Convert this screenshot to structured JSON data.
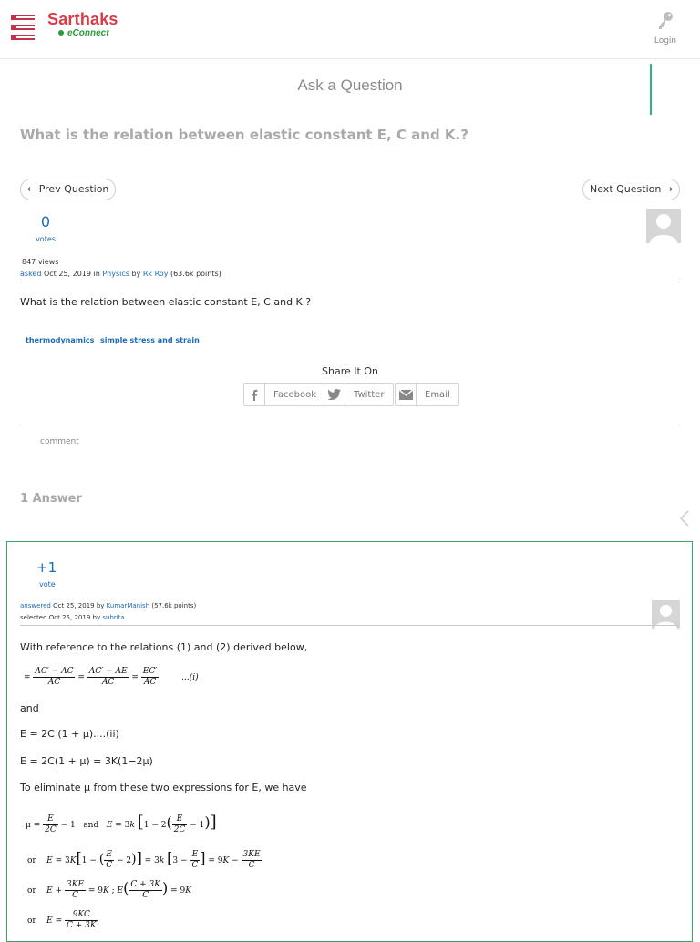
{
  "header": {
    "brand_name": "Sarthaks",
    "brand_sub": "eConnect",
    "login_label": "Login"
  },
  "ask_label": "Ask a Question",
  "question": {
    "title": "What is the relation between elastic constant E, C and K.?",
    "prev_label": "← Prev Question",
    "next_label": "Next Question →",
    "votes": "0",
    "votes_label": "votes",
    "views": "847 views",
    "asked_label": "asked",
    "asked_date": "Oct 25, 2019 in",
    "category": "Physics",
    "by_label": "by",
    "author": "Rk Roy",
    "author_points": "(63.6k points)",
    "body": "What is the relation between elastic constant E, C and K.?",
    "tags": [
      "thermodynamics",
      "simple stress and strain"
    ]
  },
  "share": {
    "title": "Share It On",
    "facebook": "Facebook",
    "twitter": "Twitter",
    "email": "Email"
  },
  "comment_label": "comment",
  "answer_count": "1 Answer",
  "answer": {
    "votes": "+1",
    "votes_label": "vote",
    "answered_label": "answered",
    "answered_date": "Oct 25, 2019 by",
    "answerer": "KumarManish",
    "answerer_points": "(57.6k points)",
    "selected_label": "selected Oct 25, 2019 by",
    "selected_by": "subrita",
    "intro": "With reference to the relations (1) and (2)  derived below,",
    "eq1_tag": "...(i)",
    "and_text": "and",
    "eq2": "E = 2C (1 + μ)....(ii)",
    "eq3": "E = 2C(1 + μ) = 3K(1−2μ)",
    "eliminate": "To eliminate μ from these two expressions for E, we have"
  },
  "colors": {
    "brand": "#d83c46",
    "brand_green": "#2e9a3e",
    "link": "#1b6ab3",
    "answer_border": "#39a463",
    "accent_line": "#2bb38a"
  }
}
